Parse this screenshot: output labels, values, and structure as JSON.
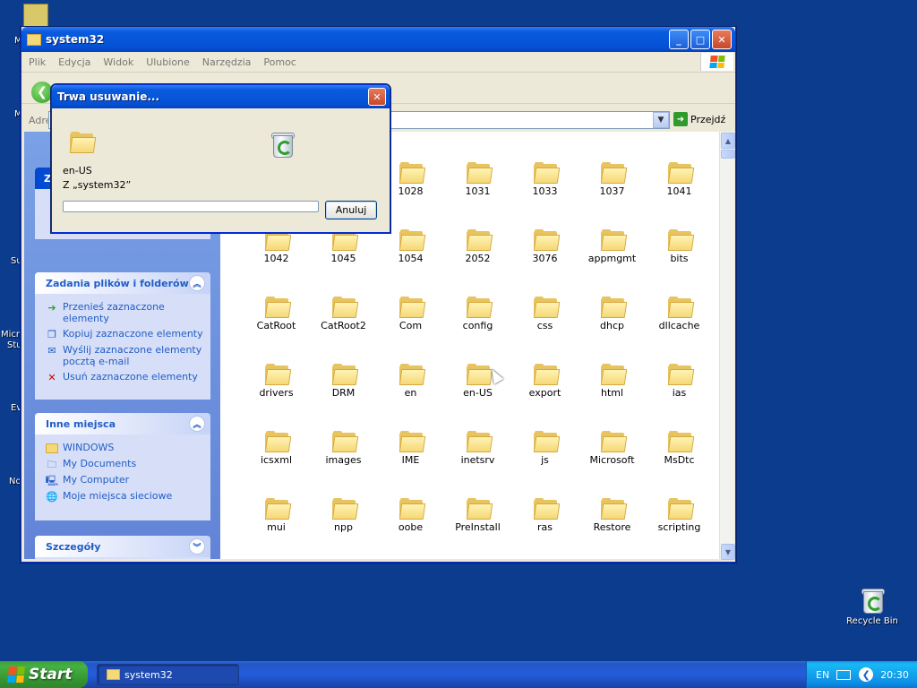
{
  "desktop": {
    "left_labels": [
      "M",
      "M",
      "Su",
      "Micro",
      "Stu",
      "Ev",
      "No"
    ],
    "recycle_bin_label": "Recycle Bin"
  },
  "explorer": {
    "title": "system32",
    "menu": [
      "Plik",
      "Edycja",
      "Widok",
      "Ulubione",
      "Narzędzia",
      "Pomoc"
    ],
    "address_label": "Adres",
    "go_label": "Przejdź",
    "task_panel_partial_header": "Z",
    "file_tasks": {
      "header": "Zadania plików i folderów",
      "items": [
        {
          "label": "Przenieś zaznaczone elementy",
          "icon": "move-icon"
        },
        {
          "label": "Kopiuj zaznaczone elementy",
          "icon": "copy-icon"
        },
        {
          "label": "Wyślij zaznaczone elementy pocztą e-mail",
          "icon": "email-icon"
        },
        {
          "label": "Usuń zaznaczone elementy",
          "icon": "delete-icon"
        }
      ]
    },
    "other_places": {
      "header": "Inne miejsca",
      "items": [
        {
          "label": "WINDOWS",
          "icon": "folder-icon"
        },
        {
          "label": "My Documents",
          "icon": "documents-icon"
        },
        {
          "label": "My Computer",
          "icon": "computer-icon"
        },
        {
          "label": "Moje miejsca sieciowe",
          "icon": "network-icon"
        }
      ]
    },
    "details": {
      "header": "Szczegóły"
    },
    "folders": [
      [
        "",
        "",
        "1028",
        "1031",
        "1033",
        "1037",
        "1041"
      ],
      [
        "1042",
        "1045",
        "1054",
        "2052",
        "3076",
        "appmgmt",
        "bits"
      ],
      [
        "CatRoot",
        "CatRoot2",
        "Com",
        "config",
        "css",
        "dhcp",
        "dllcache"
      ],
      [
        "drivers",
        "DRM",
        "en",
        "en-US",
        "export",
        "html",
        "ias"
      ],
      [
        "icsxml",
        "images",
        "IME",
        "inetsrv",
        "js",
        "Microsoft",
        "MsDtc"
      ],
      [
        "mui",
        "npp",
        "oobe",
        "PreInstall",
        "ras",
        "Restore",
        "scripting"
      ],
      [
        "",
        "",
        "",
        "",
        "",
        "",
        ""
      ]
    ]
  },
  "dialog": {
    "title": "Trwa usuwanie...",
    "item_name": "en-US",
    "from_text": "Z „system32”",
    "cancel_label": "Anuluj",
    "progress": 0
  },
  "taskbar": {
    "start_label": "Start",
    "window_button": "system32",
    "language": "EN",
    "clock": "20:30"
  },
  "colors": {
    "desktop": "#0c3c8e",
    "title_blue": "#0551d6",
    "task_link": "#215dc6",
    "folder_yellow": "#f5d877"
  }
}
